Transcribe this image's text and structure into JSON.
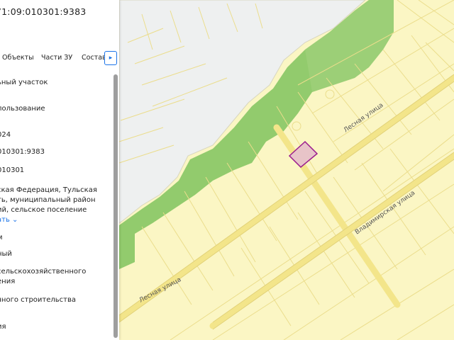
{
  "header": {
    "title": "71:09:010301:9383"
  },
  "tabs": [
    {
      "label": "Объекты"
    },
    {
      "label": "Части ЗУ"
    },
    {
      "label": "Состав"
    }
  ],
  "tab_next_icon": "chevron-right-icon",
  "attributes": [
    {
      "line1": "ьный участок"
    },
    {
      "line1": "пользование"
    },
    {
      "line1": "024"
    },
    {
      "line1": "010301:9383"
    },
    {
      "line1": "010301"
    },
    {
      "line1": "ская Федерация, Тульская",
      "line2": "ть, муниципальный район",
      "line3": "ий, сельское поселение",
      "link": "ать"
    },
    {
      "line1": "м"
    },
    {
      "line1": "ный"
    },
    {
      "line1": "сельскохозяйственного",
      "line2": "ения"
    },
    {
      "line1": "чного строительства"
    },
    {
      "line1": "ия"
    }
  ],
  "map": {
    "streets": {
      "lesnaya_upper": "Лесная улица",
      "lesnaya_lower": "Лесная улица",
      "vladimirskaya": "Владимирская улица"
    },
    "colors": {
      "land": "#fbf6c4",
      "parcel_lines": "#ebdd8c",
      "water": "#eef0f0",
      "forest": "#8cc868",
      "highlight_fill": "#e8c4c8",
      "highlight_stroke": "#9b1c8e"
    }
  }
}
